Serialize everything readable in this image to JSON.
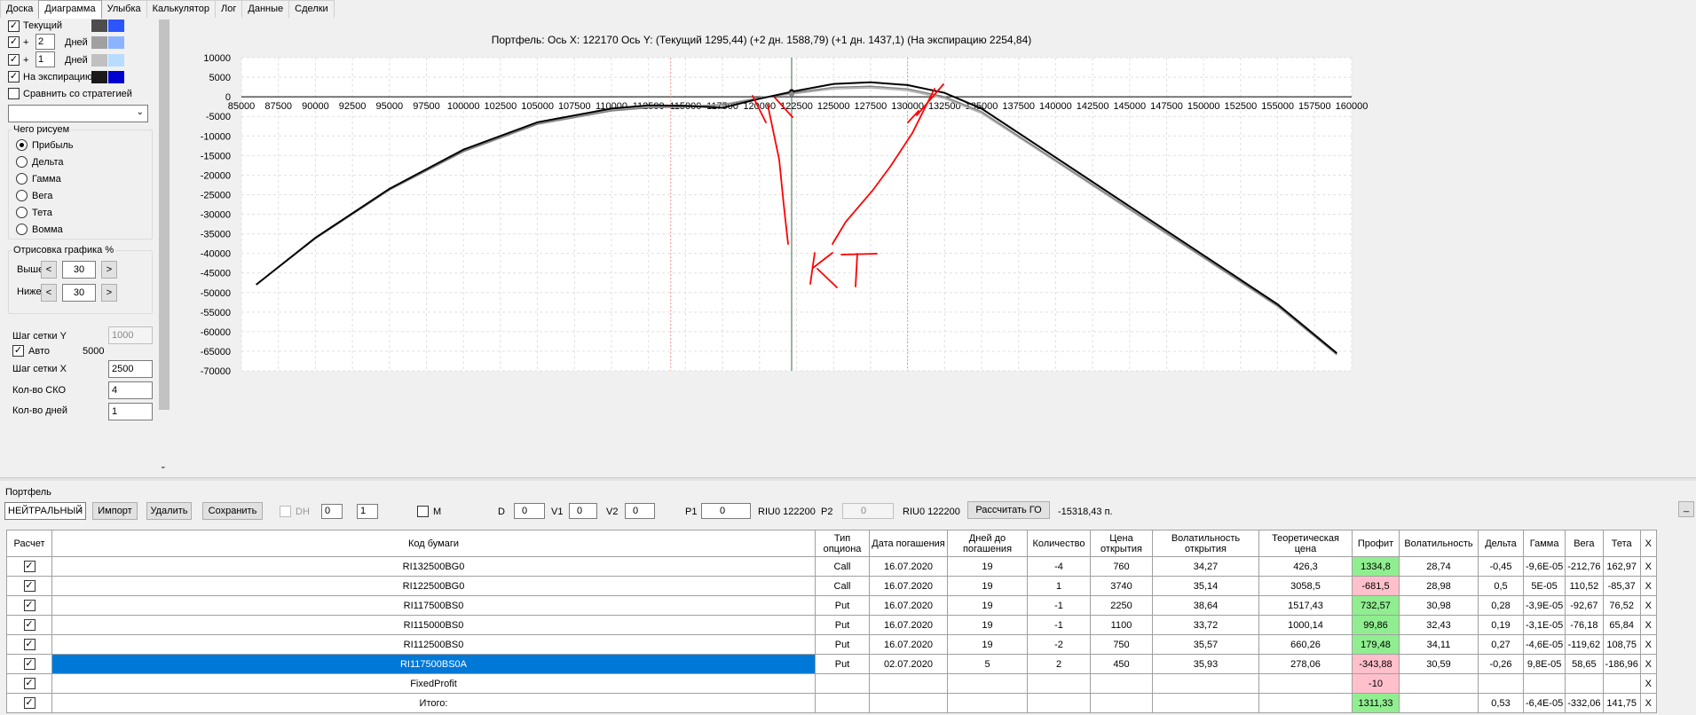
{
  "tabs": [
    "Доска",
    "Диаграмма",
    "Улыбка",
    "Калькулятор",
    "Лог",
    "Данные",
    "Сделки"
  ],
  "active_tab": 1,
  "left": {
    "current_label": "Текущий",
    "plus1": "+",
    "days1": "2",
    "days_label1": "Дней",
    "plus2": "+",
    "days2": "1",
    "days_label2": "Дней",
    "expiry_label": "На экспирацию",
    "compare_label": "Сравнить со стратегией",
    "what_group": "Чего рисуем",
    "radios": [
      "Прибыль",
      "Дельта",
      "Гамма",
      "Вега",
      "Тета",
      "Вомма"
    ],
    "draw_group": "Отрисовка графика %",
    "above_label": "Выше",
    "above_value": "30",
    "below_label": "Ниже",
    "below_value": "30",
    "prev_glyph": "<",
    "next_glyph": ">",
    "grid_y_label": "Шаг сетки Y",
    "grid_y_value": "1000",
    "auto_label": "Авто",
    "auto_value": "5000",
    "grid_x_label": "Шаг сетки X",
    "grid_x_value": "2500",
    "sko_label": "Кол-во СКО",
    "sko_value": "4",
    "days_count_label": "Кол-во дней",
    "days_count_value": "1",
    "colors": {
      "current": [
        "#4d4d4d",
        "#2a55ff"
      ],
      "d2": [
        "#a0a0a0",
        "#8ab4ff"
      ],
      "d1": [
        "#c0c0c0",
        "#b8dcff"
      ],
      "exp": [
        "#1a1a1a",
        "#0000d0"
      ]
    }
  },
  "chart_data": {
    "type": "line",
    "title": "Портфель: Ось X:  122170 Ось Y:  (Текущий 1295,44)  (+2 дн. 1588,79)  (+1 дн. 1437,1)  (На экспирацию 2254,84)",
    "xlim": [
      85000,
      160000
    ],
    "ylim": [
      -70000,
      10000
    ],
    "x_ticks": [
      85000,
      87500,
      90000,
      92500,
      95000,
      97500,
      100000,
      102500,
      105000,
      107500,
      110000,
      112500,
      115000,
      117500,
      120000,
      122500,
      125000,
      127500,
      130000,
      132500,
      135000,
      137500,
      140000,
      142500,
      145000,
      147500,
      150000,
      152500,
      155000,
      157500,
      160000
    ],
    "y_ticks": [
      10000,
      5000,
      0,
      -5000,
      -10000,
      -15000,
      -20000,
      -25000,
      -30000,
      -35000,
      -40000,
      -45000,
      -50000,
      -55000,
      -60000,
      -65000,
      -70000
    ],
    "current_x": 122170,
    "red_lines_x": [
      114000,
      130000
    ],
    "series": [
      {
        "x": [
          86000,
          90000,
          95000,
          100000,
          105000,
          110000,
          112500,
          115000,
          117500,
          120000,
          122170,
          125000,
          127500,
          130000,
          132500,
          135000,
          140000,
          145000,
          150000,
          155000,
          159000
        ],
        "y": [
          -48000,
          -36000,
          -23500,
          -13500,
          -6500,
          -3000,
          -2200,
          -2300,
          -2800,
          -500,
          1295,
          3300,
          3700,
          3000,
          1000,
          -3000,
          -15500,
          -28000,
          -40500,
          -53000,
          -65500
        ],
        "color": "#000000"
      },
      {
        "x": [
          86000,
          90000,
          95000,
          100000,
          105000,
          110000,
          112500,
          115000,
          117500,
          120000,
          122170,
          125000,
          127500,
          130000,
          132500,
          135000,
          140000,
          145000,
          150000,
          155000,
          159000
        ],
        "y": [
          -48000,
          -36200,
          -23800,
          -14000,
          -7000,
          -3600,
          -2800,
          -2600,
          -2100,
          -400,
          1000,
          2400,
          2700,
          2000,
          0,
          -3800,
          -16200,
          -28600,
          -41000,
          -53400,
          -65800
        ],
        "color": "#808080"
      },
      {
        "x": [
          86000,
          90000,
          95000,
          100000,
          105000,
          110000,
          112500,
          115000,
          117500,
          120000,
          122170,
          125000,
          127500,
          130000,
          132500,
          135000,
          140000,
          145000,
          150000,
          155000,
          159000
        ],
        "y": [
          -48000,
          -36100,
          -23700,
          -13800,
          -6800,
          -3300,
          -2500,
          -2400,
          -2000,
          -200,
          700,
          2000,
          2300,
          1600,
          -400,
          -4200,
          -16500,
          -28900,
          -41200,
          -53600,
          -65900
        ],
        "color": "#b0b0b0"
      }
    ]
  },
  "annotation_text": "КТ",
  "bottom": {
    "portfolio_label": "Портфель",
    "strategy": "НЕЙТРАЛЬНЫЙ",
    "import": "Импорт",
    "delete": "Удалить",
    "save": "Сохранить",
    "dh_label": "DH",
    "dh_a": "0",
    "dh_b": "1",
    "m_label": "M",
    "d_label": "D",
    "d_value": "0",
    "v1_label": "V1",
    "v1_value": "0",
    "v2_label": "V2",
    "v2_value": "0",
    "p1_label": "P1",
    "p1_value": "0",
    "riu_label1": "RIU0 122200",
    "p2_label": "P2",
    "p2_value": "0",
    "riu_label2": "RIU0 122200",
    "calc_go": "Рассчитать ГО",
    "go_value": "-15318,43 п.",
    "close_btn": "_"
  },
  "table": {
    "headers": [
      "Расчет",
      "Код бумаги",
      "Тип опциона",
      "Дата погашения",
      "Дней до погашения",
      "Количество",
      "Цена открытия",
      "Волатильность открытия",
      "Теоретическая цена",
      "Профит",
      "Волатильность",
      "Дельта",
      "Гамма",
      "Вега",
      "Тета",
      "X"
    ],
    "rows": [
      [
        "✓",
        "RI132500BG0",
        "Call",
        "16.07.2020",
        "19",
        "-4",
        "760",
        "34,27",
        "426,3",
        "1334,8",
        "28,74",
        "-0,45",
        "-9,6E-05",
        "-212,76",
        "162,97",
        "X"
      ],
      [
        "✓",
        "RI122500BG0",
        "Call",
        "16.07.2020",
        "19",
        "1",
        "3740",
        "35,14",
        "3058,5",
        "-681,5",
        "28,98",
        "0,5",
        "5E-05",
        "110,52",
        "-85,37",
        "X"
      ],
      [
        "✓",
        "RI117500BS0",
        "Put",
        "16.07.2020",
        "19",
        "-1",
        "2250",
        "38,64",
        "1517,43",
        "732,57",
        "30,98",
        "0,28",
        "-3,9E-05",
        "-92,67",
        "76,52",
        "X"
      ],
      [
        "✓",
        "RI115000BS0",
        "Put",
        "16.07.2020",
        "19",
        "-1",
        "1100",
        "33,72",
        "1000,14",
        "99,86",
        "32,43",
        "0,19",
        "-3,1E-05",
        "-76,18",
        "65,84",
        "X"
      ],
      [
        "✓",
        "RI112500BS0",
        "Put",
        "16.07.2020",
        "19",
        "-2",
        "750",
        "35,57",
        "660,26",
        "179,48",
        "34,11",
        "0,27",
        "-4,6E-05",
        "-119,62",
        "108,75",
        "X"
      ],
      [
        "✓",
        "RI117500BS0A",
        "Put",
        "02.07.2020",
        "5",
        "2",
        "450",
        "35,93",
        "278,06",
        "-343,88",
        "30,59",
        "-0,26",
        "9,8E-05",
        "58,65",
        "-186,96",
        "X"
      ],
      [
        "✓",
        "FixedProfit",
        "",
        "",
        "",
        "",
        "",
        "",
        "",
        "-10",
        "",
        "",
        "",
        "",
        "",
        "X"
      ],
      [
        "✓",
        "Итого:",
        "",
        "",
        "",
        "",
        "",
        "",
        "",
        "1311,33",
        "",
        "0,53",
        "-6,4E-05",
        "-332,06",
        "141,75",
        "X"
      ]
    ],
    "profit_colors": [
      "green",
      "pink",
      "green",
      "green",
      "green",
      "pink",
      "pink",
      "green"
    ]
  }
}
